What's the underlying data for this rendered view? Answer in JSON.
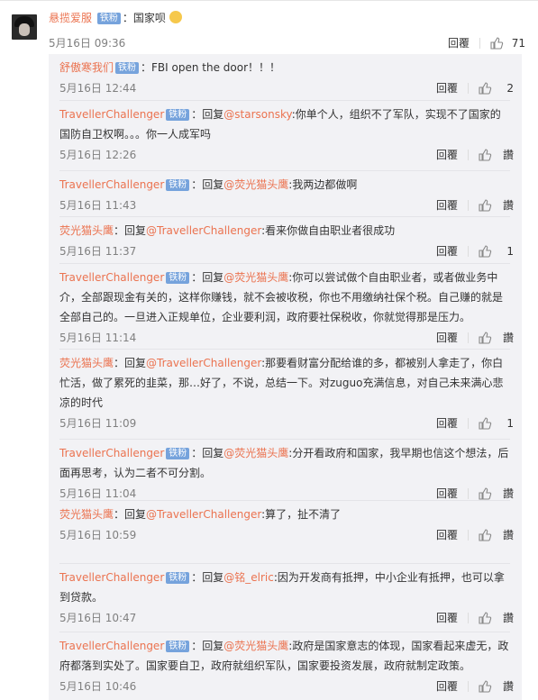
{
  "top_comment": {
    "user": "悬揽爱服",
    "badge": "铁粉",
    "text": "：国家呗",
    "time": "5月16日 09:36",
    "reply": "回覆",
    "likes": "71"
  },
  "replies": [
    {
      "user": "舒傲寒我们",
      "badge": "铁粉",
      "pre": "：FBI open the door！！！",
      "at": "",
      "post": "",
      "time": "5月16日 12:44",
      "reply": "回覆",
      "likes": "2"
    },
    {
      "user": "TravellerChallenger",
      "badge": "铁粉",
      "pre": "：回复",
      "at": "@starsonsky",
      "post": ":你单个人，组织不了军队，实现不了国家的国防自卫权啊。。。你一人成军吗",
      "time": "5月16日 12:26",
      "reply": "回覆",
      "likes": "讚"
    },
    {
      "user": "TravellerChallenger",
      "badge": "铁粉",
      "pre": "：回复",
      "at": "@荧光猫头鹰",
      "post": ":我两边都做啊",
      "time": "5月16日 11:43",
      "reply": "回覆",
      "likes": "讚"
    },
    {
      "user": "荧光猫头鹰",
      "badge": "",
      "pre": "：回复",
      "at": "@TravellerChallenger",
      "post": ":看来你做自由职业者很成功",
      "time": "5月16日 11:37",
      "reply": "回覆",
      "likes": "1"
    },
    {
      "user": "TravellerChallenger",
      "badge": "铁粉",
      "pre": "：回复",
      "at": "@荧光猫头鹰",
      "post": ":你可以尝试做个自由职业者，或者做业务中介，全部跟现金有关的，这样你赚钱，就不会被收税，你也不用缴纳社保个税。自己赚的就是全部自己的。一旦进入正规单位，企业要利润，政府要社保税收，你就觉得那是压力。",
      "time": "5月16日 11:14",
      "reply": "回覆",
      "likes": "讚"
    },
    {
      "user": "荧光猫头鹰",
      "badge": "",
      "pre": "：回复",
      "at": "@TravellerChallenger",
      "post": ":那要看财富分配给谁的多，都被别人拿走了，你白忙活，做了累死的韭菜，那…好了，不说，总结一下。对zuguo充满信息，对自己未来满心悲凉的时代",
      "time": "5月16日 11:09",
      "reply": "回覆",
      "likes": "1"
    },
    {
      "user": "TravellerChallenger",
      "badge": "铁粉",
      "pre": "：回复",
      "at": "@荧光猫头鹰",
      "post": ":分开看政府和国家，我早期也信这个想法，后面再思考，认为二者不可分割。",
      "time": "5月16日 11:04",
      "reply": "回覆",
      "likes": "讚"
    },
    {
      "user": "荧光猫头鹰",
      "badge": "",
      "pre": "：回复",
      "at": "@TravellerChallenger",
      "post": ":算了，扯不清了",
      "time": "5月16日 10:59",
      "reply": "回覆",
      "likes": "讚"
    },
    {
      "user": "TravellerChallenger",
      "badge": "铁粉",
      "pre": "：回复",
      "at": "@铭_elric",
      "post": ":因为开发商有抵押，中小企业有抵押，也可以拿到贷款。",
      "time": "5月16日 10:47",
      "reply": "回覆",
      "likes": "讚"
    },
    {
      "user": "TravellerChallenger",
      "badge": "铁粉",
      "pre": "：回复",
      "at": "@荧光猫头鹰",
      "post": ":政府是国家意志的体现，国家看起来虚无，政府都落到实处了。国家要自卫，政府就组织军队，国家要投资发展，政府就制定政策。",
      "time": "5月16日 10:46",
      "reply": "回覆",
      "likes": "讚"
    }
  ]
}
